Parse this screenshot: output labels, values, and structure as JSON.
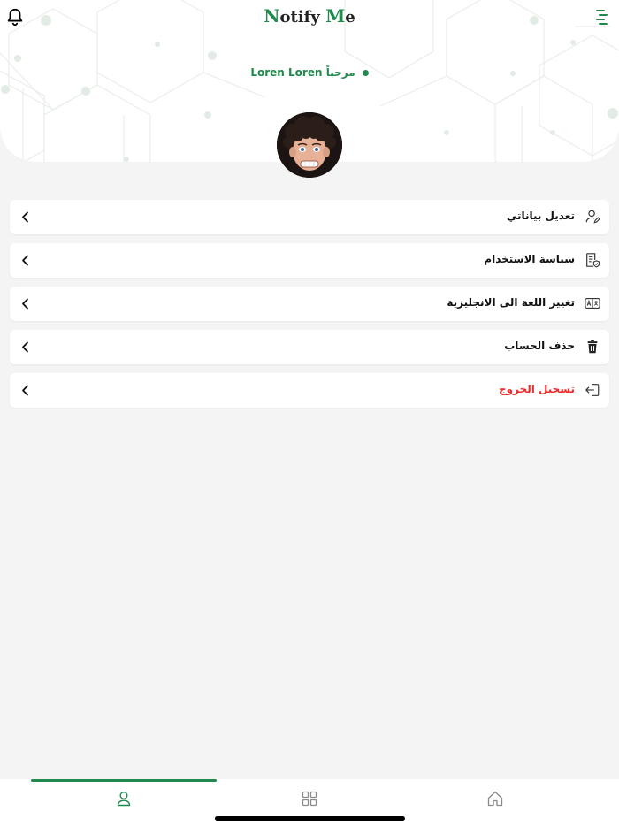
{
  "header": {
    "brand_first": "N",
    "brand_middle": "otify ",
    "brand_accent": "M",
    "brand_last": "e",
    "welcome_text": "مرحباً Loren Loren",
    "bell_icon": "bell-icon",
    "menu_icon": "menu-icon"
  },
  "menu": {
    "items": [
      {
        "label": "تعديل بياناتي",
        "icon": "user-edit-icon",
        "color": "#111111"
      },
      {
        "label": "سياسة الاستخدام",
        "icon": "policy-document-icon",
        "color": "#111111"
      },
      {
        "label": "تغيير اللغة الى الانجليزية",
        "icon": "translate-icon",
        "color": "#111111"
      },
      {
        "label": "حذف الحساب",
        "icon": "trash-icon",
        "color": "#111111"
      },
      {
        "label": "تسجيل الخروج",
        "icon": "logout-icon",
        "color": "#ef2b2b"
      }
    ]
  },
  "nav": {
    "tabs": [
      {
        "icon": "profile-icon",
        "active": true
      },
      {
        "icon": "grid-icon",
        "active": false
      },
      {
        "icon": "home-icon",
        "active": false
      }
    ]
  },
  "colors": {
    "accent": "#1f8a4c",
    "danger": "#ef2b2b",
    "background": "#f4f4f4"
  }
}
